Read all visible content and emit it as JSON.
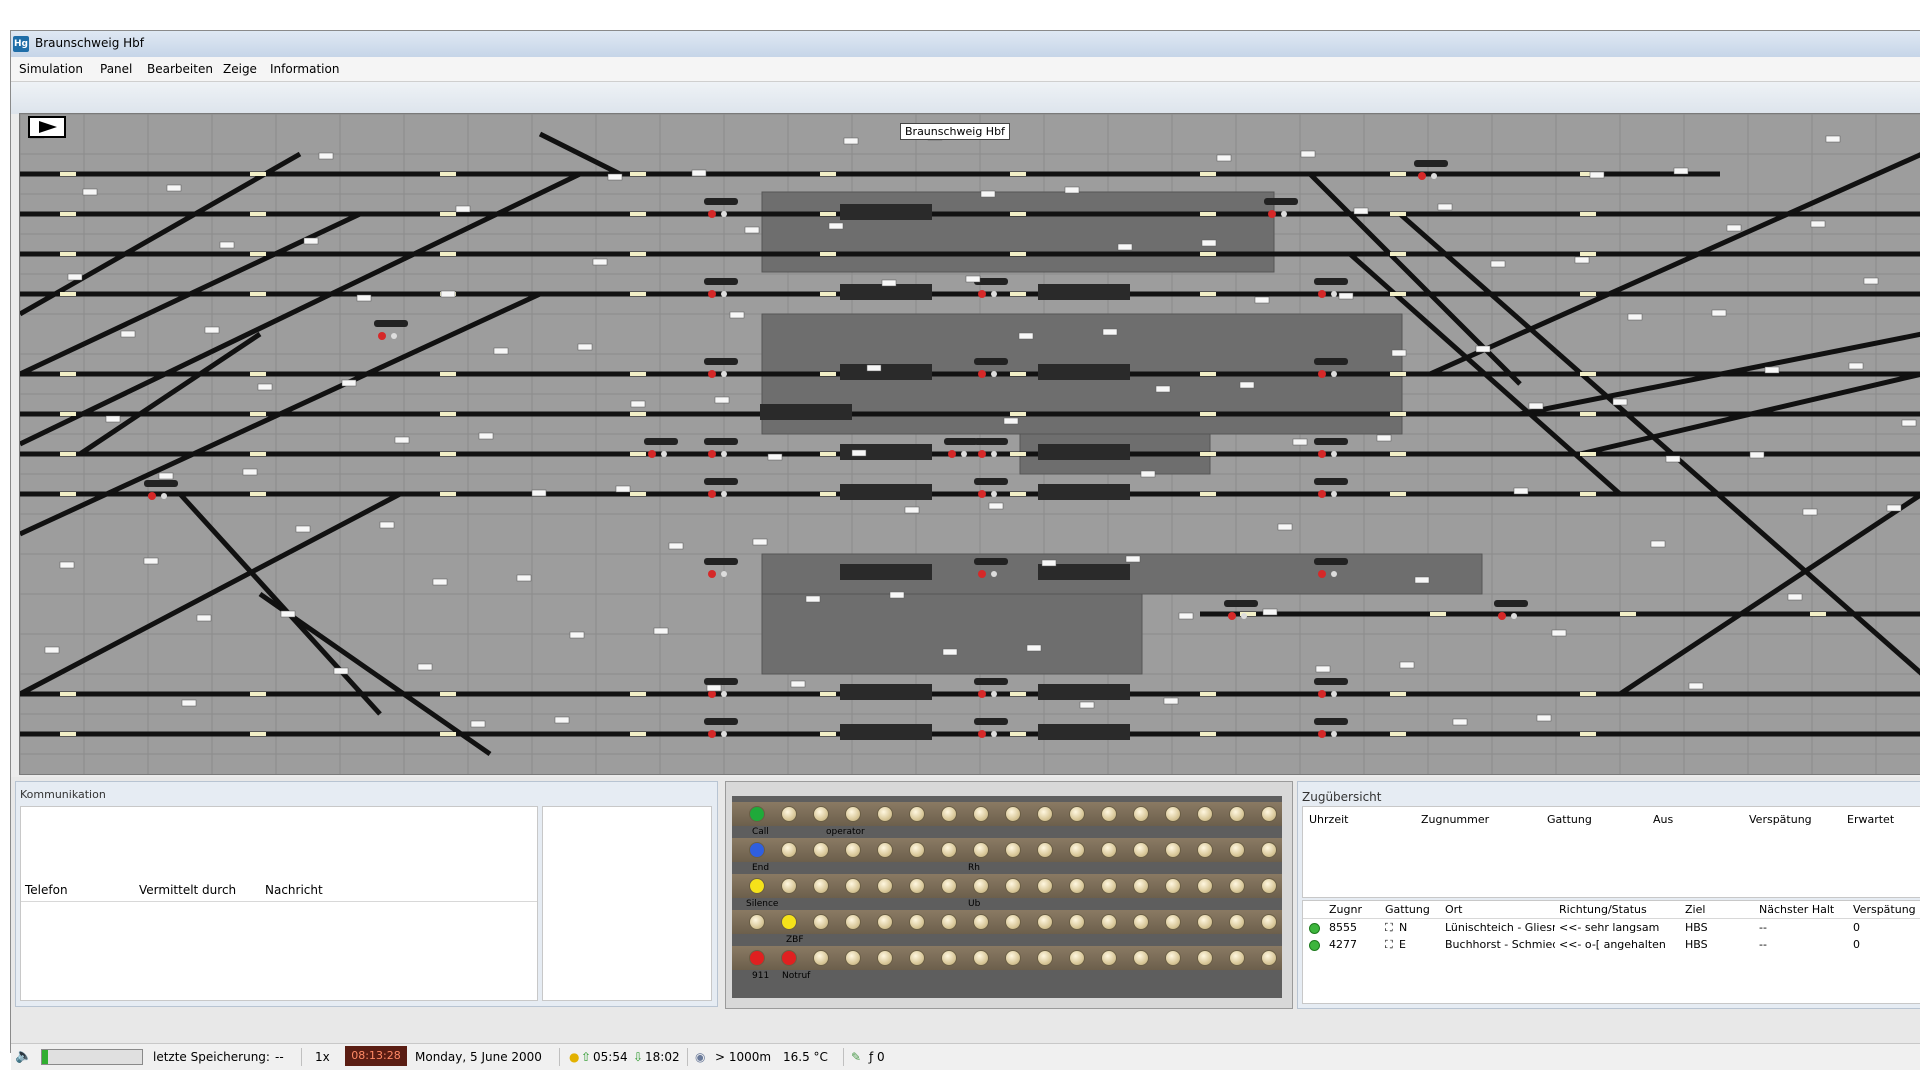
{
  "window": {
    "title": "Braunschweig Hbf",
    "icon": "app-icon"
  },
  "menu": [
    "Simulation",
    "Panel",
    "Bearbeiten",
    "Zeige",
    "Information"
  ],
  "panel": {
    "station_label": "Braunschweig Hbf"
  },
  "kommunikation": {
    "title": "Kommunikation",
    "columns": [
      "Telefon",
      "Vermittelt durch",
      "Nachricht"
    ]
  },
  "dial": {
    "labels": {
      "call": "Call",
      "operator": "operator",
      "end": "End",
      "rh": "Rh",
      "silence": "Silence",
      "ub": "Ub",
      "zbf": "ZBF",
      "n911": "911",
      "notruf": "Notruf"
    },
    "colors": {
      "green": "#1faa3a",
      "blue": "#2f5fe0",
      "yellow": "#f5e21a",
      "red": "#e02020"
    }
  },
  "zugubersicht": {
    "title": "Zugübersicht",
    "top_columns": [
      "Uhrzeit",
      "Zugnummer",
      "Gattung",
      "Aus",
      "Verspätung",
      "Erwartet"
    ],
    "bottom_columns": [
      "Zugnr",
      "Gattung",
      "Ort",
      "Richtung/Status",
      "Ziel",
      "Nächster Halt",
      "Verspätung"
    ],
    "rows": [
      {
        "zugnr": "8555",
        "gattung": "N",
        "ort": "Lünischteich - Gliesma",
        "richtung": "<<- sehr langsam",
        "ziel": "HBS",
        "naechster": "--",
        "verspaetung": "0"
      },
      {
        "zugnr": "4277",
        "gattung": "E",
        "ort": "Buchhorst - Schmiede",
        "richtung": "<<- o-[ angehalten",
        "ziel": "HBS",
        "naechster": "--",
        "verspaetung": "0"
      }
    ]
  },
  "status": {
    "progress": 0.06,
    "save_label": "letzte Speicherung:",
    "save_value": "--",
    "speed": "1x",
    "clock": "08:13:28",
    "date": "Monday, 5 June 2000",
    "sunrise": "05:54",
    "sunset": "18:02",
    "visibility": "> 1000m",
    "temperature": "16.5 °C",
    "counter": "ƒ 0"
  }
}
